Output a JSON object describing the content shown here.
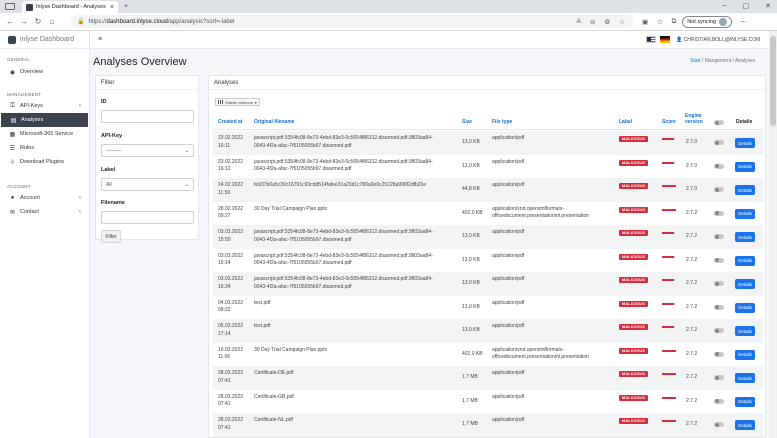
{
  "browser": {
    "tab_title": "Inlyse Dashboard - Analyses",
    "url_scheme": "https://",
    "url_host": "dashboard.inlyse.cloud",
    "url_path": "/app/analysis?sort=-label",
    "sync_label": "Not syncing"
  },
  "sidebar": {
    "brand": "inlyse Dashboard",
    "section_general": "GENERAL",
    "overview": "Overview",
    "section_management": "MANAGEMENT",
    "api_keys": "API-Keys",
    "analyses": "Analyses",
    "microsoft": "Microsoft-365 Service",
    "rules": "Rules",
    "download_plugins": "Download Plugins",
    "section_account": "ACCOUNT",
    "account": "Account",
    "contact": "Contact"
  },
  "header": {
    "user_email": "CHRISTIAN.BOLL@INLYSE.COM"
  },
  "page": {
    "title": "Analyses Overview",
    "breadcrumb_start": "Start",
    "breadcrumb_sep1": " / ",
    "breadcrumb_mgmt": "Mangement",
    "breadcrumb_sep2": " / ",
    "breadcrumb_current": "Analyses"
  },
  "filter": {
    "title": "Filter",
    "id_label": "ID",
    "id_value": "",
    "api_key_label": "API-Key",
    "api_key_value": "---------",
    "label_label": "Label",
    "label_value": "All",
    "filename_label": "Filename",
    "filename_value": "",
    "button": "Filter"
  },
  "analyses": {
    "title": "Analyses",
    "visible_columns": "Visible columns",
    "columns": {
      "created_at": "Created at",
      "filename": "Original filename",
      "size": "Size",
      "file_type": "File type",
      "label": "Label",
      "score": "Score",
      "engine_version_1": "Engine",
      "engine_version_2": "version",
      "details": "Details"
    },
    "details_label": "Details",
    "rows": [
      {
        "date": "23.02.2022",
        "time": "16:11",
        "fn1": "javascript.pdf.5354fc08-8e73-4ebd-83e3-0c5054f86312.disarmed.pdf.9803aa84-",
        "fn2": "0043-4f2a-afac-7f5105055b97.disarmed.pdf",
        "size": "13,0 KB",
        "ft1": "application/pdf",
        "ft2": "",
        "label": "MALICIOUS",
        "score": 0.85,
        "version": "2.7.0"
      },
      {
        "date": "23.02.2022",
        "time": "16:12",
        "fn1": "javascript.pdf.5354fc08-8e73-4ebd-83e3-0c5054f86312.disarmed.pdf.9803aa84-",
        "fn2": "0043-4f2a-afac-7f5105055b97.disarmed.pdf",
        "size": "13,0 KB",
        "ft1": "application/pdf",
        "ft2": "",
        "label": "MALICIOUS",
        "score": 0.85,
        "version": "2.7.0"
      },
      {
        "date": "24.02.2022",
        "time": "11:59",
        "fn1": "fe937b0a5c30c16791c93cdd514fafee31a23d1c780a3e0c25228a996f2dfb20e",
        "fn2": "",
        "size": "44,8 KB",
        "ft1": "application/pdf",
        "ft2": "",
        "label": "MALICIOUS",
        "score": 1.0,
        "version": "2.7.0"
      },
      {
        "date": "28.02.2022",
        "time": "09:27",
        "fn1": "30 Day Trial Campaign Plan.pptx",
        "fn2": "",
        "size": "402,0 KB",
        "ft1": "application/vnd.openxmlformats-",
        "ft2": "officedocument.presentationml.presentation",
        "label": "MALICIOUS",
        "score": 1.0,
        "version": "2.7.2"
      },
      {
        "date": "03.03.2022",
        "time": "15:50",
        "fn1": "javascript.pdf.5354fc08-8e73-4ebd-83e3-0c5054f86312.disarmed.pdf.9803aa84-",
        "fn2": "0043-4f2a-afac-7f5105055b97.disarmed.pdf",
        "size": "13,0 KB",
        "ft1": "application/pdf",
        "ft2": "",
        "label": "MALICIOUS",
        "score": 0.85,
        "version": "2.7.2"
      },
      {
        "date": "03.03.2022",
        "time": "16:14",
        "fn1": "javascript.pdf.5354fc08-8e73-4ebd-83e3-0c5054f86312.disarmed.pdf.9803aa84-",
        "fn2": "0043-4f2a-afac-7f5105055b97.disarmed.pdf",
        "size": "13,0 KB",
        "ft1": "application/pdf",
        "ft2": "",
        "label": "MALICIOUS",
        "score": 0.85,
        "version": "2.7.2"
      },
      {
        "date": "03.03.2022",
        "time": "16:34",
        "fn1": "javascript.pdf.5354fc08-8e73-4ebd-83e3-0c5054f86312.disarmed.pdf.9803aa84-",
        "fn2": "0043-4f2a-afac-7f5105055b97.disarmed.pdf",
        "size": "13,0 KB",
        "ft1": "application/pdf",
        "ft2": "",
        "label": "MALICIOUS",
        "score": 0.85,
        "version": "2.7.2"
      },
      {
        "date": "04.03.2022",
        "time": "09:22",
        "fn1": "test.pdf",
        "fn2": "",
        "size": "13,0 KB",
        "ft1": "application/pdf",
        "ft2": "",
        "label": "MALICIOUS",
        "score": 0.85,
        "version": "2.7.2"
      },
      {
        "date": "05.03.2022",
        "time": "17:14",
        "fn1": "test.pdf",
        "fn2": "",
        "size": "13,0 KB",
        "ft1": "application/pdf",
        "ft2": "",
        "label": "MALICIOUS",
        "score": 0.85,
        "version": "2.7.2"
      },
      {
        "date": "16.03.2022",
        "time": "11:06",
        "fn1": "30 Day Trial Campaign Plan.pptx",
        "fn2": "",
        "size": "402,0 KB",
        "ft1": "application/vnd.openxmlformats-",
        "ft2": "officedocument.presentationml.presentation",
        "label": "MALICIOUS",
        "score": 1.0,
        "version": "2.7.2"
      },
      {
        "date": "28.03.2022",
        "time": "07:41",
        "fn1": "Certificate-DE.pdf",
        "fn2": "",
        "size": "1,7 MB",
        "ft1": "application/pdf",
        "ft2": "",
        "label": "MALICIOUS",
        "score": 1.0,
        "version": "2.7.2"
      },
      {
        "date": "28.03.2022",
        "time": "07:41",
        "fn1": "Certificate-GB.pdf",
        "fn2": "",
        "size": "1,7 MB",
        "ft1": "application/pdf",
        "ft2": "",
        "label": "MALICIOUS",
        "score": 1.0,
        "version": "2.7.2"
      },
      {
        "date": "28.03.2022",
        "time": "07:41",
        "fn1": "Certificate-NL.pdf",
        "fn2": "",
        "size": "1,7 MB",
        "ft1": "application/pdf",
        "ft2": "",
        "label": "MALICIOUS",
        "score": 1.0,
        "version": "2.7.2"
      }
    ]
  },
  "colors": {
    "malicious": "#d32f3f",
    "primary": "#1a73e8",
    "sidebar_active": "#3b4250"
  },
  "icons": {
    "back": "←",
    "forward": "→",
    "reload": "↻",
    "home": "⌂",
    "lock": "🔒",
    "menu": "≡",
    "user": "👤",
    "overview": "◉",
    "key": "⚿",
    "analyses": "▤",
    "microsoft": "▦",
    "rules": "☰",
    "download": "⇩",
    "account": "●",
    "contact": "✉",
    "chevron": "‹"
  }
}
